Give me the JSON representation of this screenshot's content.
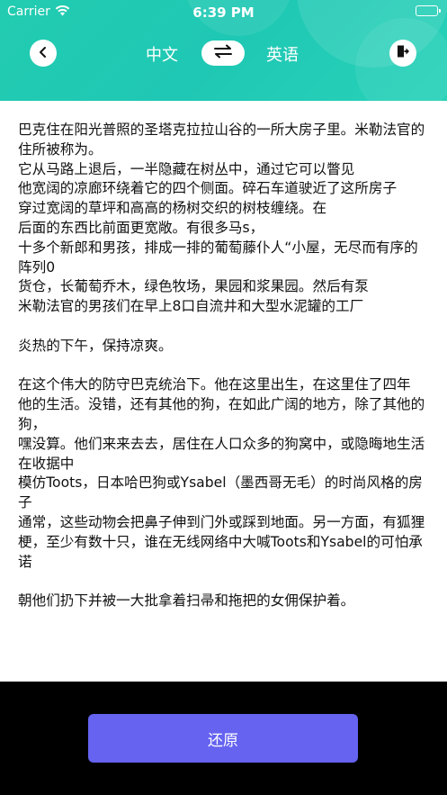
{
  "status_bar": {
    "carrier": "Carrier",
    "time": "6:39 PM"
  },
  "header": {
    "source_language": "中文",
    "target_language": "英语",
    "icons": {
      "back": "chevron-left-icon",
      "swap": "swap-arrows-icon",
      "exit": "exit-icon"
    }
  },
  "content": {
    "paragraphs": [
      "巴克住在阳光普照的圣塔克拉拉山谷的一所大房子里。米勒法官的住所被称为。\n它从马路上退后，一半隐藏在树丛中，通过它可以瞥见\n他宽阔的凉廊环绕着它的四个侧面。碎石车道驶近了这所房子\n穿过宽阔的草坪和高高的杨树交织的树枝缠绕。在\n后面的东西比前面更宽敞。有很多马s，\n十多个新郎和男孩，排成一排的葡萄藤仆人“小屋，无尽而有序的阵列0\n货仓，长葡萄乔木，绿色牧场，果园和浆果园。然后有泵\n米勒法官的男孩们在早上8口自流井和大型水泥罐的工厂",
      "炎热的下午，保持凉爽。",
      "在这个伟大的防守巴克统治下。他在这里出生，在这里住了四年\n他的生活。没错，还有其他的狗，在如此广阔的地方，除了其他的狗，\n嘿没算。他们来来去去，居住在人口众多的狗窝中，或隐晦地生活在收据中\n模仿Toots，日本哈巴狗或Ysabel（墨西哥无毛）的时尚风格的房子\n通常，这些动物会把鼻子伸到门外或踩到地面。另一方面，有狐狸\n梗，至少有数十只，谁在无线网络中大喊Toots和Ysabel的可怕承诺",
      "朝他们扔下并被一大批拿着扫帚和拖把的女佣保护着。"
    ]
  },
  "footer": {
    "restore_label": "还原"
  },
  "colors": {
    "header_gradient": "#22ccb0",
    "restore_button": "#6563f0",
    "background": "#000000"
  }
}
